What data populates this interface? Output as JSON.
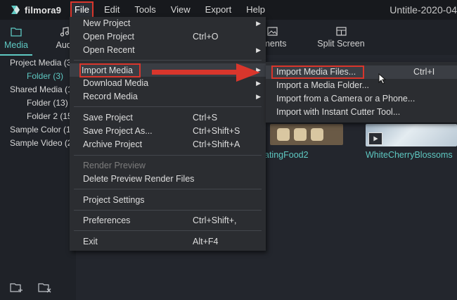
{
  "app": {
    "logo_text": "filmora9",
    "window_title": "Untitle-2020-04"
  },
  "menubar": {
    "items": [
      {
        "label": "File",
        "active": true
      },
      {
        "label": "Edit"
      },
      {
        "label": "Tools"
      },
      {
        "label": "View"
      },
      {
        "label": "Export"
      },
      {
        "label": "Help"
      }
    ]
  },
  "left_tabs": [
    {
      "label": "Media",
      "icon": "folder-icon"
    },
    {
      "label": "Audi",
      "icon": "music-note-icon"
    }
  ],
  "media_tree": [
    {
      "label": "Project Media (3",
      "indent": false,
      "selected": false
    },
    {
      "label": "Folder (3)",
      "indent": true,
      "selected": true
    },
    {
      "label": "Shared Media (1",
      "indent": false,
      "selected": false
    },
    {
      "label": "Folder (13)",
      "indent": true,
      "selected": false
    },
    {
      "label": "Folder 2 (15",
      "indent": true,
      "selected": false
    },
    {
      "label": "Sample Color (1",
      "indent": false,
      "selected": false
    },
    {
      "label": "Sample Video (2",
      "indent": false,
      "selected": false
    }
  ],
  "top_tabs": [
    {
      "label": "ements",
      "icon": "image-icon"
    },
    {
      "label": "Split Screen",
      "icon": "split-screen-icon"
    }
  ],
  "thumbnails": [
    {
      "label": "atingFood2"
    },
    {
      "label": "WhiteCherryBlossoms"
    }
  ],
  "file_menu": {
    "items": [
      {
        "label": "New Project",
        "shortcut": "",
        "submenu": true
      },
      {
        "label": "Open Project",
        "shortcut": "Ctrl+O",
        "submenu": false
      },
      {
        "label": "Open Recent",
        "shortcut": "",
        "submenu": true
      },
      {
        "label": "Import Media",
        "shortcut": "",
        "submenu": true,
        "highlighted": true
      },
      {
        "label": "Download Media",
        "shortcut": "",
        "submenu": true
      },
      {
        "label": "Record Media",
        "shortcut": "",
        "submenu": true
      },
      {
        "label": "Save Project",
        "shortcut": "Ctrl+S",
        "submenu": false
      },
      {
        "label": "Save Project As...",
        "shortcut": "Ctrl+Shift+S",
        "submenu": false
      },
      {
        "label": "Archive Project",
        "shortcut": "Ctrl+Shift+A",
        "submenu": false
      },
      {
        "label": "Render Preview",
        "shortcut": "",
        "submenu": false,
        "disabled": true
      },
      {
        "label": "Delete Preview Render Files",
        "shortcut": "",
        "submenu": false
      },
      {
        "label": "Project Settings",
        "shortcut": "",
        "submenu": false
      },
      {
        "label": "Preferences",
        "shortcut": "Ctrl+Shift+,",
        "submenu": false
      },
      {
        "label": "Exit",
        "shortcut": "Alt+F4",
        "submenu": false
      }
    ]
  },
  "import_submenu": {
    "items": [
      {
        "label": "Import Media Files...",
        "shortcut": "Ctrl+I",
        "highlighted": true
      },
      {
        "label": "Import a Media Folder...",
        "shortcut": ""
      },
      {
        "label": "Import from a Camera or a Phone...",
        "shortcut": ""
      },
      {
        "label": "Import with Instant Cutter Tool...",
        "shortcut": ""
      }
    ]
  },
  "colors": {
    "accent": "#5ec8c2",
    "highlight_border": "#d9362c",
    "menu_bg": "#2b2d31"
  }
}
